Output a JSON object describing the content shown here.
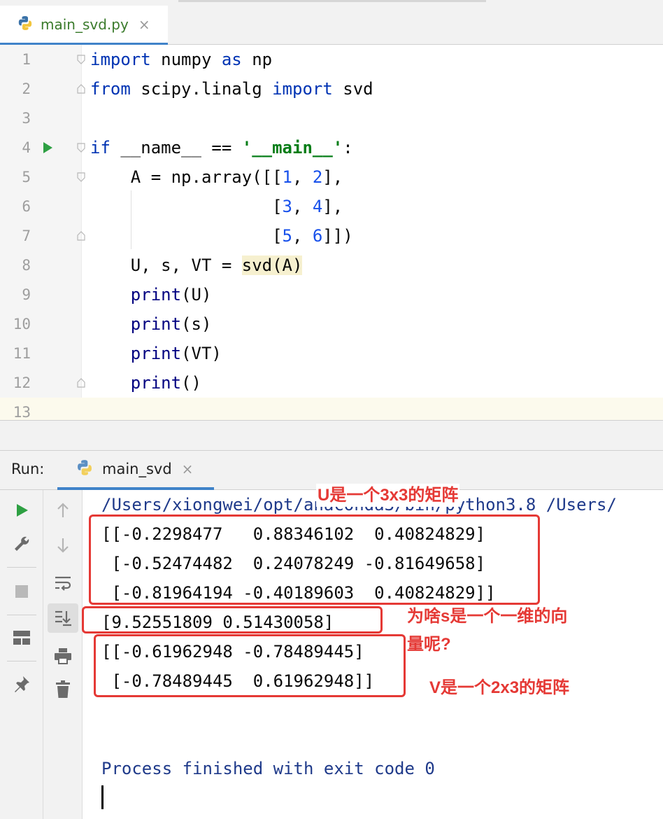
{
  "editor_tab": {
    "filename": "main_svd.py",
    "close": "×"
  },
  "editor": {
    "line_numbers": [
      "1",
      "2",
      "3",
      "4",
      "5",
      "6",
      "7",
      "8",
      "9",
      "10",
      "11",
      "12",
      "13"
    ],
    "code": {
      "l1": {
        "kw1": "import",
        "t1": " numpy ",
        "kw2": "as",
        "t2": " np"
      },
      "l2": {
        "kw1": "from",
        "t1": " scipy.linalg ",
        "kw2": "import",
        "t2": " svd"
      },
      "l4": {
        "kw1": "if",
        "t1": " __name__ == ",
        "str": "'__main__'",
        "t2": ":"
      },
      "l5": {
        "t1": "    A = np.array([[",
        "n1": "1",
        "t2": ", ",
        "n2": "2",
        "t3": "],"
      },
      "l6": {
        "t1": "                  [",
        "n1": "3",
        "t2": ", ",
        "n2": "4",
        "t3": "],"
      },
      "l7": {
        "t1": "                  [",
        "n1": "5",
        "t2": ", ",
        "n2": "6",
        "t3": "]])"
      },
      "l8": {
        "t1": "    U, s, VT = ",
        "hl": "svd(A)"
      },
      "l9": {
        "fn": "print",
        "t1": "(U)"
      },
      "l10": {
        "fn": "print",
        "t1": "(s)"
      },
      "l11": {
        "fn": "print",
        "t1": "(VT)"
      },
      "l12": {
        "fn": "print",
        "t1": "()"
      }
    }
  },
  "run_panel": {
    "title": "Run:",
    "tab_label": "main_svd",
    "tab_close": "×"
  },
  "console": {
    "path": "/Users/xiongwei/opt/anaconda3/bin/python3.8 /Users/",
    "u_rows": [
      "[[-0.2298477   0.88346102  0.40824829]",
      " [-0.52474482  0.24078249 -0.81649658]",
      " [-0.81964194 -0.40189603  0.40824829]]"
    ],
    "s_row": "[9.52551809 0.51430058]",
    "vt_rows": [
      "[[-0.61962948 -0.78489445]",
      " [-0.78489445  0.61962948]]"
    ],
    "process": "Process finished with exit code 0"
  },
  "annotations": {
    "u_note": "U是一个3x3的矩阵",
    "s_note_line1": "为啥s是一个一维的向",
    "s_note_line2": "量呢?",
    "v_note": "V是一个2x3的矩阵"
  },
  "colors": {
    "keyword": "#0033b3",
    "string": "#067d17",
    "number": "#1750eb",
    "annotation_red": "#e53935",
    "tab_underline": "#4083c9",
    "run_green": "#2ea043"
  }
}
